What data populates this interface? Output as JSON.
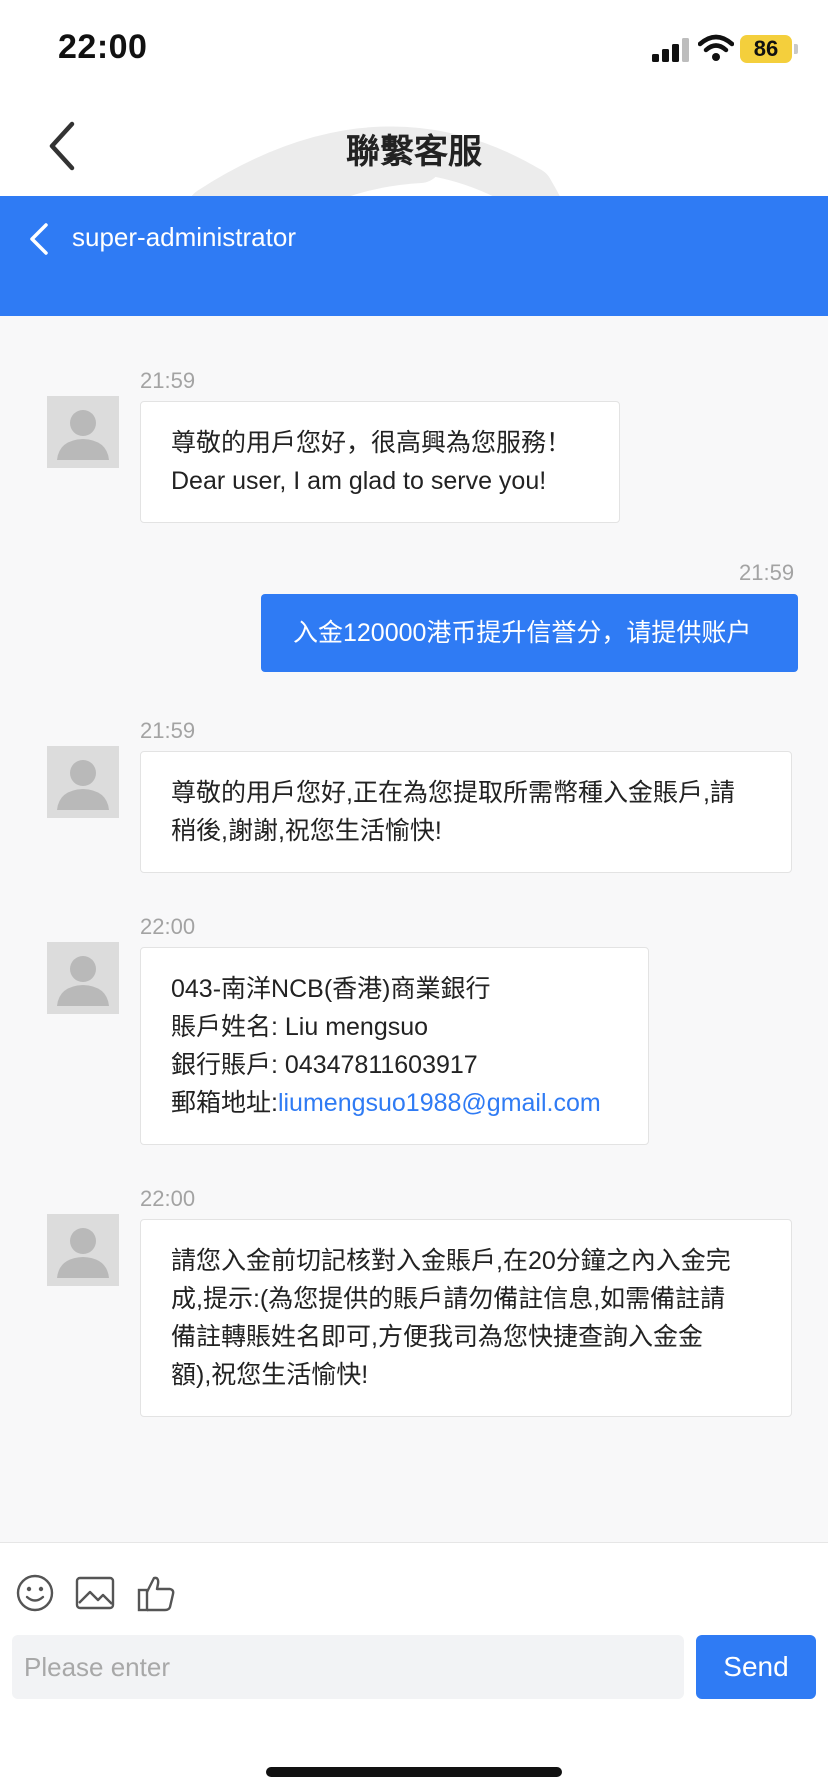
{
  "status_bar": {
    "time": "22:00",
    "battery": "86"
  },
  "nav": {
    "title": "聯繫客服"
  },
  "chat_header": {
    "name": "super-administrator"
  },
  "messages": [
    {
      "direction": "incoming",
      "time": "21:59",
      "lines": [
        "尊敬的用戶您好，很高興為您服務！",
        "Dear user, I am glad to serve you!"
      ]
    },
    {
      "direction": "outgoing",
      "time": "21:59",
      "text": "入金120000港币提升信誉分，请提供账户"
    },
    {
      "direction": "incoming",
      "time": "21:59",
      "lines": [
        "尊敬的用戶您好,正在為您提取所需幣種入金賬戶,請",
        "稍後,謝謝,祝您生活愉快!"
      ]
    },
    {
      "direction": "incoming",
      "time": "22:00",
      "lines": [
        "043-南洋NCB(香港)商業銀行",
        "賬戶姓名: Liu mengsuo",
        "銀行賬戶: 04347811603917"
      ],
      "email_label": "郵箱地址:",
      "email_link": "liumengsuo1988@gmail.com"
    },
    {
      "direction": "incoming",
      "time": "22:00",
      "lines": [
        "請您入金前切記核對入金賬戶,在20分鐘之內入金完",
        "成,提示:(為您提供的賬戶請勿備註信息,如需備註請",
        "備註轉賬姓名即可,方便我司為您快捷查詢入金金",
        "額),祝您生活愉快!"
      ]
    }
  ],
  "input": {
    "placeholder": "Please enter",
    "value": "",
    "send_label": "Send"
  },
  "toolbar": {
    "icons": [
      "emoji-icon",
      "image-icon",
      "thumbs-up-icon"
    ]
  },
  "colors": {
    "accent": "#2f7bf4",
    "chat_bg": "#f8f8f9",
    "battery": "#f4cf3c"
  }
}
